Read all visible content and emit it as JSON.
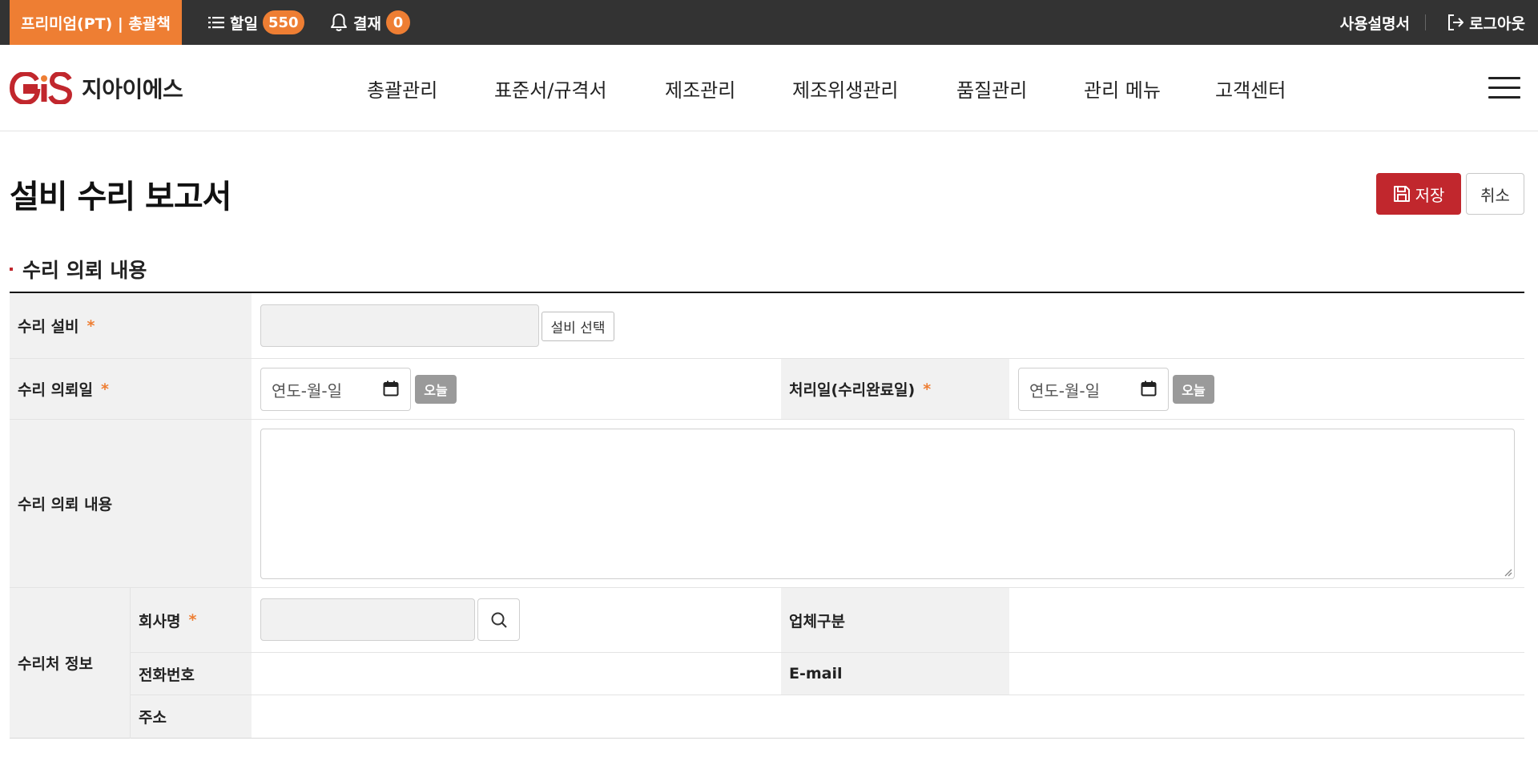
{
  "topbar": {
    "plan": "프리미엄(PT) | 총괄책",
    "todo_label": "할일",
    "todo_count": "550",
    "approval_label": "결재",
    "approval_count": "0",
    "manual": "사용설명서",
    "logout": "로그아웃",
    "icons": {
      "todo": "list-icon",
      "approval": "bell-icon",
      "logout": "logout-icon"
    },
    "accent_color": "#ee7e33",
    "background_color": "#333333"
  },
  "header": {
    "logo_mark": "GS",
    "logo_text": "지아이에스",
    "nav": [
      "총괄관리",
      "표준서/규격서",
      "제조관리",
      "제조위생관리",
      "품질관리",
      "관리 메뉴",
      "고객센터"
    ],
    "brand_color": "#c1272d"
  },
  "page": {
    "title": "설비 수리 보고서",
    "save": "저장",
    "cancel": "취소",
    "save_color": "#c1272d"
  },
  "section": {
    "title": "수리 의뢰 내용",
    "fields": {
      "equipment_label": "수리 설비",
      "equipment_value": "",
      "equipment_select": "설비 선택",
      "request_date_label": "수리 의뢰일",
      "request_date_placeholder": "연도-월-일",
      "today": "오늘",
      "done_date_label": "처리일(수리완료일)",
      "done_date_placeholder": "연도-월-일",
      "content_label": "수리 의뢰 내용",
      "content_value": "",
      "vendor_group_label": "수리처 정보",
      "company_label": "회사명",
      "company_value": "",
      "vendor_type_label": "업체구분",
      "vendor_type_value": "",
      "phone_label": "전화번호",
      "phone_value": "",
      "email_label": "E-mail",
      "email_value": "",
      "address_label": "주소",
      "address_value": ""
    },
    "required_mark": "*"
  }
}
